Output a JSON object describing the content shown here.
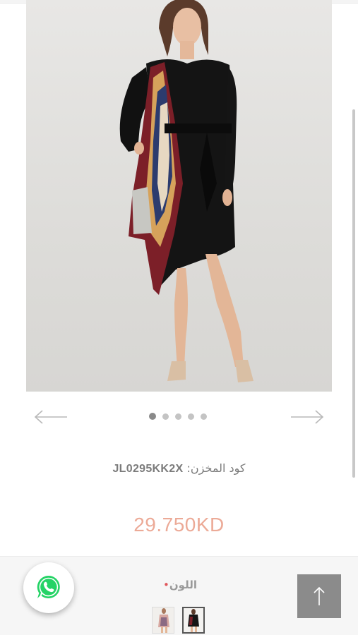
{
  "product": {
    "image_alt": "Black wrap dress with scarf print panel",
    "carousel": {
      "slide_count": 5,
      "active_index": 0
    },
    "sku": {
      "label": "كود المخزن:",
      "value": "JL0295KK2X"
    },
    "price": "29.750KD"
  },
  "options": {
    "color_label": "اللون",
    "required_mark": "•",
    "swatches": [
      {
        "name": "printed-dress",
        "selected": false
      },
      {
        "name": "black-dress",
        "selected": true
      }
    ]
  },
  "icons": {
    "prev": "arrow-left-icon",
    "next": "arrow-right-icon",
    "whatsapp": "whatsapp-icon",
    "scroll_top": "arrow-up-icon"
  },
  "colors": {
    "price": "#ecaa97",
    "whatsapp": "#25d366",
    "scroll_top_bg": "#8b8b8b"
  }
}
